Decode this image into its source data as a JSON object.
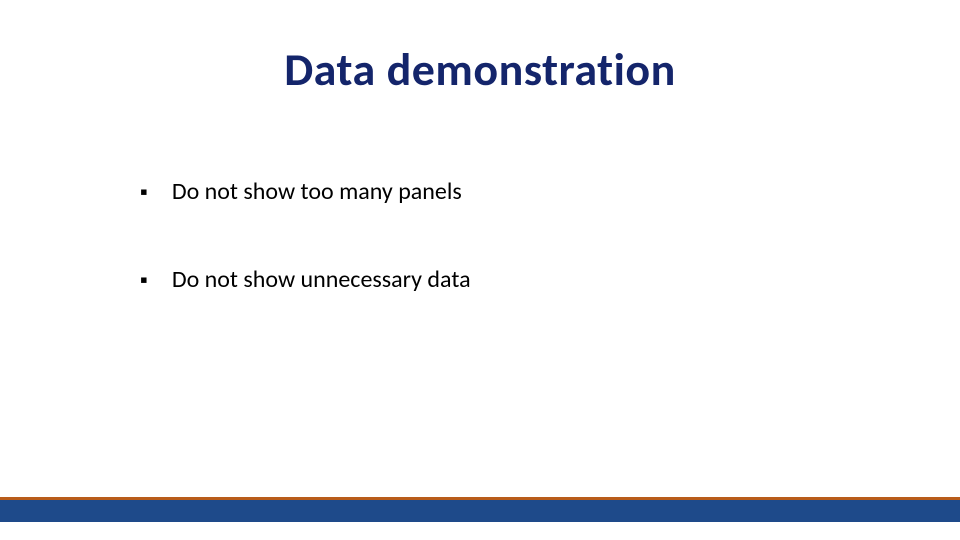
{
  "slide": {
    "title": "Data demonstration",
    "bullets": [
      {
        "text": "Do not show too many panels"
      },
      {
        "text": "Do not show unnecessary data"
      }
    ]
  },
  "colors": {
    "title": "#14256b",
    "footer_bar": "#1e4a8a",
    "footer_accent": "#b85c1a"
  }
}
